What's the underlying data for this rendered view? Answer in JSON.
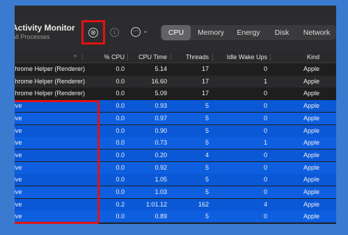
{
  "app": {
    "title": "Activity Monitor",
    "subtitle": "All Processes"
  },
  "toolbar": {
    "stop_glyph": "⊗",
    "info_glyph": "i",
    "more_glyph": "···",
    "chevron_glyph": "⌄"
  },
  "tabs": [
    {
      "label": "CPU",
      "active": true
    },
    {
      "label": "Memory",
      "active": false
    },
    {
      "label": "Energy",
      "active": false
    },
    {
      "label": "Disk",
      "active": false
    },
    {
      "label": "Network",
      "active": false
    }
  ],
  "columns": {
    "sort_arrow": "^",
    "cpu": "% CPU",
    "cpu_time": "CPU Time",
    "threads": "Threads",
    "idle_wake_ups": "Idle Wake Ups",
    "kind": "Kind"
  },
  "rows": [
    {
      "name": "Chrome Helper (Renderer)",
      "cpu": "0.0",
      "cpu_time": "5.14",
      "threads": "17",
      "idle": "0",
      "kind": "Apple"
    },
    {
      "name": "Chrome Helper (Renderer)",
      "cpu": "0.0",
      "cpu_time": "16.60",
      "threads": "17",
      "idle": "1",
      "kind": "Apple"
    },
    {
      "name": "Chrome Helper (Renderer)",
      "cpu": "0.0",
      "cpu_time": "5.09",
      "threads": "17",
      "idle": "0",
      "kind": "Apple"
    },
    {
      "name": "Live",
      "cpu": "0.0",
      "cpu_time": "0.93",
      "threads": "5",
      "idle": "0",
      "kind": "Apple"
    },
    {
      "name": "Live",
      "cpu": "0.0",
      "cpu_time": "0.97",
      "threads": "5",
      "idle": "0",
      "kind": "Apple"
    },
    {
      "name": "Live",
      "cpu": "0.0",
      "cpu_time": "0.90",
      "threads": "5",
      "idle": "0",
      "kind": "Apple"
    },
    {
      "name": "Live",
      "cpu": "0.0",
      "cpu_time": "0.73",
      "threads": "5",
      "idle": "1",
      "kind": "Apple"
    },
    {
      "name": "Live",
      "cpu": "0.0",
      "cpu_time": "0.20",
      "threads": "4",
      "idle": "0",
      "kind": "Apple"
    },
    {
      "name": "Live",
      "cpu": "0.0",
      "cpu_time": "0.92",
      "threads": "5",
      "idle": "0",
      "kind": "Apple"
    },
    {
      "name": "Live",
      "cpu": "0.0",
      "cpu_time": "1.05",
      "threads": "5",
      "idle": "0",
      "kind": "Apple"
    },
    {
      "name": "Live",
      "cpu": "0.0",
      "cpu_time": "1.03",
      "threads": "5",
      "idle": "0",
      "kind": "Apple"
    },
    {
      "name": "Live",
      "cpu": "0.2",
      "cpu_time": "1:01.12",
      "threads": "162",
      "idle": "4",
      "kind": "Apple"
    },
    {
      "name": "Live",
      "cpu": "0.0",
      "cpu_time": "0.89",
      "threads": "5",
      "idle": "0",
      "kind": "Apple"
    }
  ],
  "colors": {
    "desktop": "#3a7bd0",
    "window_bg": "#1f1f21",
    "selection_blue": "#0a58d6",
    "annotation_red": "#e31212"
  }
}
